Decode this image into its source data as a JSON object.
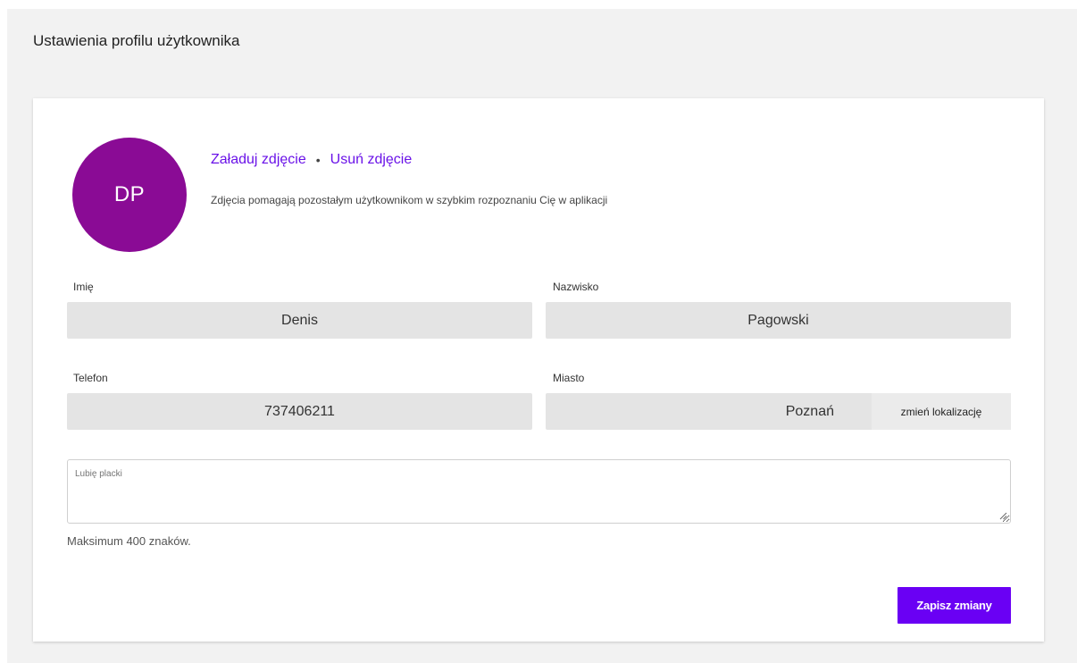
{
  "page": {
    "title": "Ustawienia profilu użytkownika"
  },
  "profile": {
    "avatar_initials": "DP",
    "avatar_color": "#8a0b95",
    "upload_photo_label": "Załaduj zdjęcie",
    "separator": "•",
    "remove_photo_label": "Usuń zdjęcie",
    "photo_hint": "Zdjęcia pomagają pozostałym użytkownikom w szybkim rozpoznaniu Cię w aplikacji"
  },
  "form": {
    "first_name": {
      "label": "Imię",
      "value": "Denis"
    },
    "last_name": {
      "label": "Nazwisko",
      "value": "Pagowski"
    },
    "phone": {
      "label": "Telefon",
      "value": "737406211"
    },
    "city": {
      "label": "Miasto",
      "value": "Poznań",
      "change_location_label": "zmień lokalizację"
    },
    "bio": {
      "placeholder": "Lubię placki",
      "value": "",
      "hint": "Maksimum 400 znaków."
    },
    "save_label": "Zapisz zmiany"
  },
  "colors": {
    "accent": "#6a00f4",
    "link": "#6a12e8",
    "field_bg": "#e4e4e4",
    "page_bg": "#f2f2f2"
  }
}
